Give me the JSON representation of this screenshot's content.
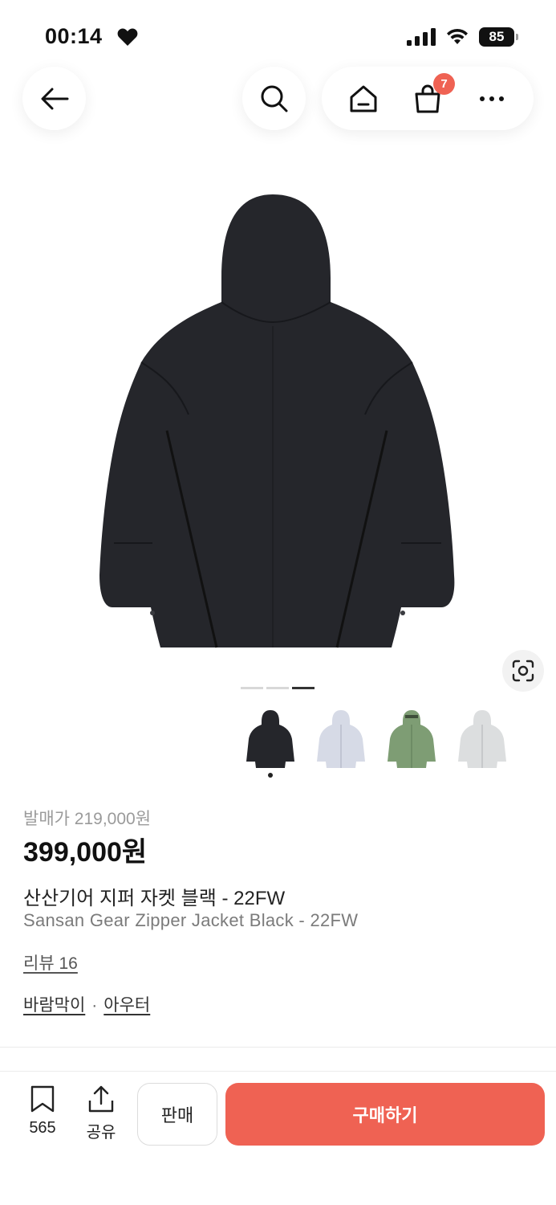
{
  "status_bar": {
    "time": "00:14",
    "battery": "85"
  },
  "nav": {
    "cart_badge": "7"
  },
  "gallery": {
    "page_count": 3,
    "current_page": 3
  },
  "thumbnails": [
    {
      "color": "#25262b",
      "selected": true
    },
    {
      "color": "#d6dae6",
      "selected": false
    },
    {
      "color": "#7e9d74",
      "selected": false
    },
    {
      "color": "#dcdedf",
      "selected": false
    }
  ],
  "product": {
    "release_price": "발매가 219,000원",
    "price": "399,000원",
    "title_ko": "산산기어 지퍼 자켓 블랙 - 22FW",
    "title_en": "Sansan Gear Zipper Jacket Black - 22FW",
    "review_link": "리뷰 16",
    "category_1": "바람막이",
    "category_sep": "·",
    "category_2": "아우터"
  },
  "bottom_bar": {
    "bookmark_count": "565",
    "share_label": "공유",
    "sell_label": "판매",
    "buy_label": "구매하기"
  },
  "colors": {
    "accent": "#ef6253",
    "jacket": "#25262b"
  }
}
